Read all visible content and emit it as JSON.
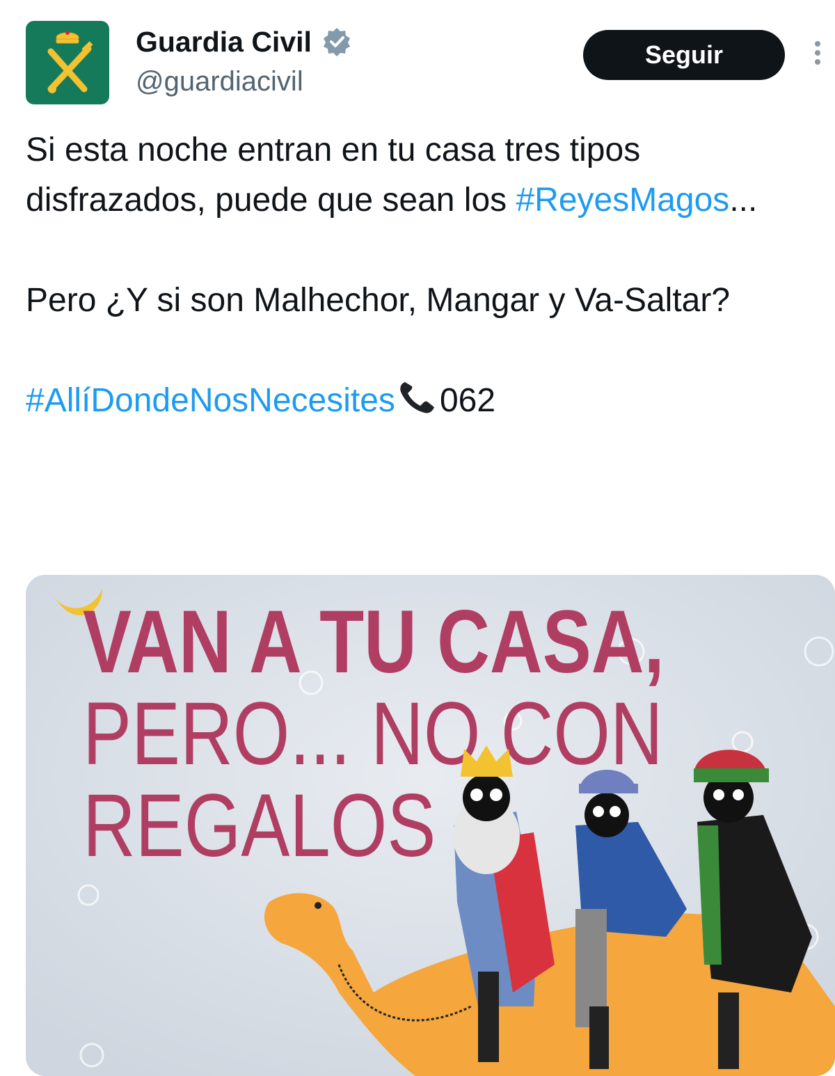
{
  "tweet": {
    "author_name": "Guardia Civil",
    "author_handle": "@guardiacivil",
    "follow_label": "Seguir",
    "verified_icon": "verified-badge-icon",
    "more_icon": "more-vertical-icon",
    "line1_a": "Si esta noche entran en tu casa tres tipos disfrazados, puede que sean los ",
    "hashtag1": "#ReyesMagos",
    "line1_b": "...",
    "line2": "Pero ¿Y si son Malhechor, Mangar y Va-Saltar?",
    "hashtag2": "#AllíDondeNosNecesites",
    "phone_icon": "telephone-icon",
    "phone_number": "062",
    "colors": {
      "link": "#1d9bf0",
      "button": "#0f1419",
      "avatar_bg": "#157a5a"
    }
  },
  "media": {
    "poster_line1": "VAN A TU CASA,",
    "poster_line2": "PERO... NO CON",
    "poster_line3": "REGALOS",
    "colors": {
      "headline": "#b03e63",
      "camel": "#f5a63c",
      "background": "#d9dfe6"
    }
  }
}
